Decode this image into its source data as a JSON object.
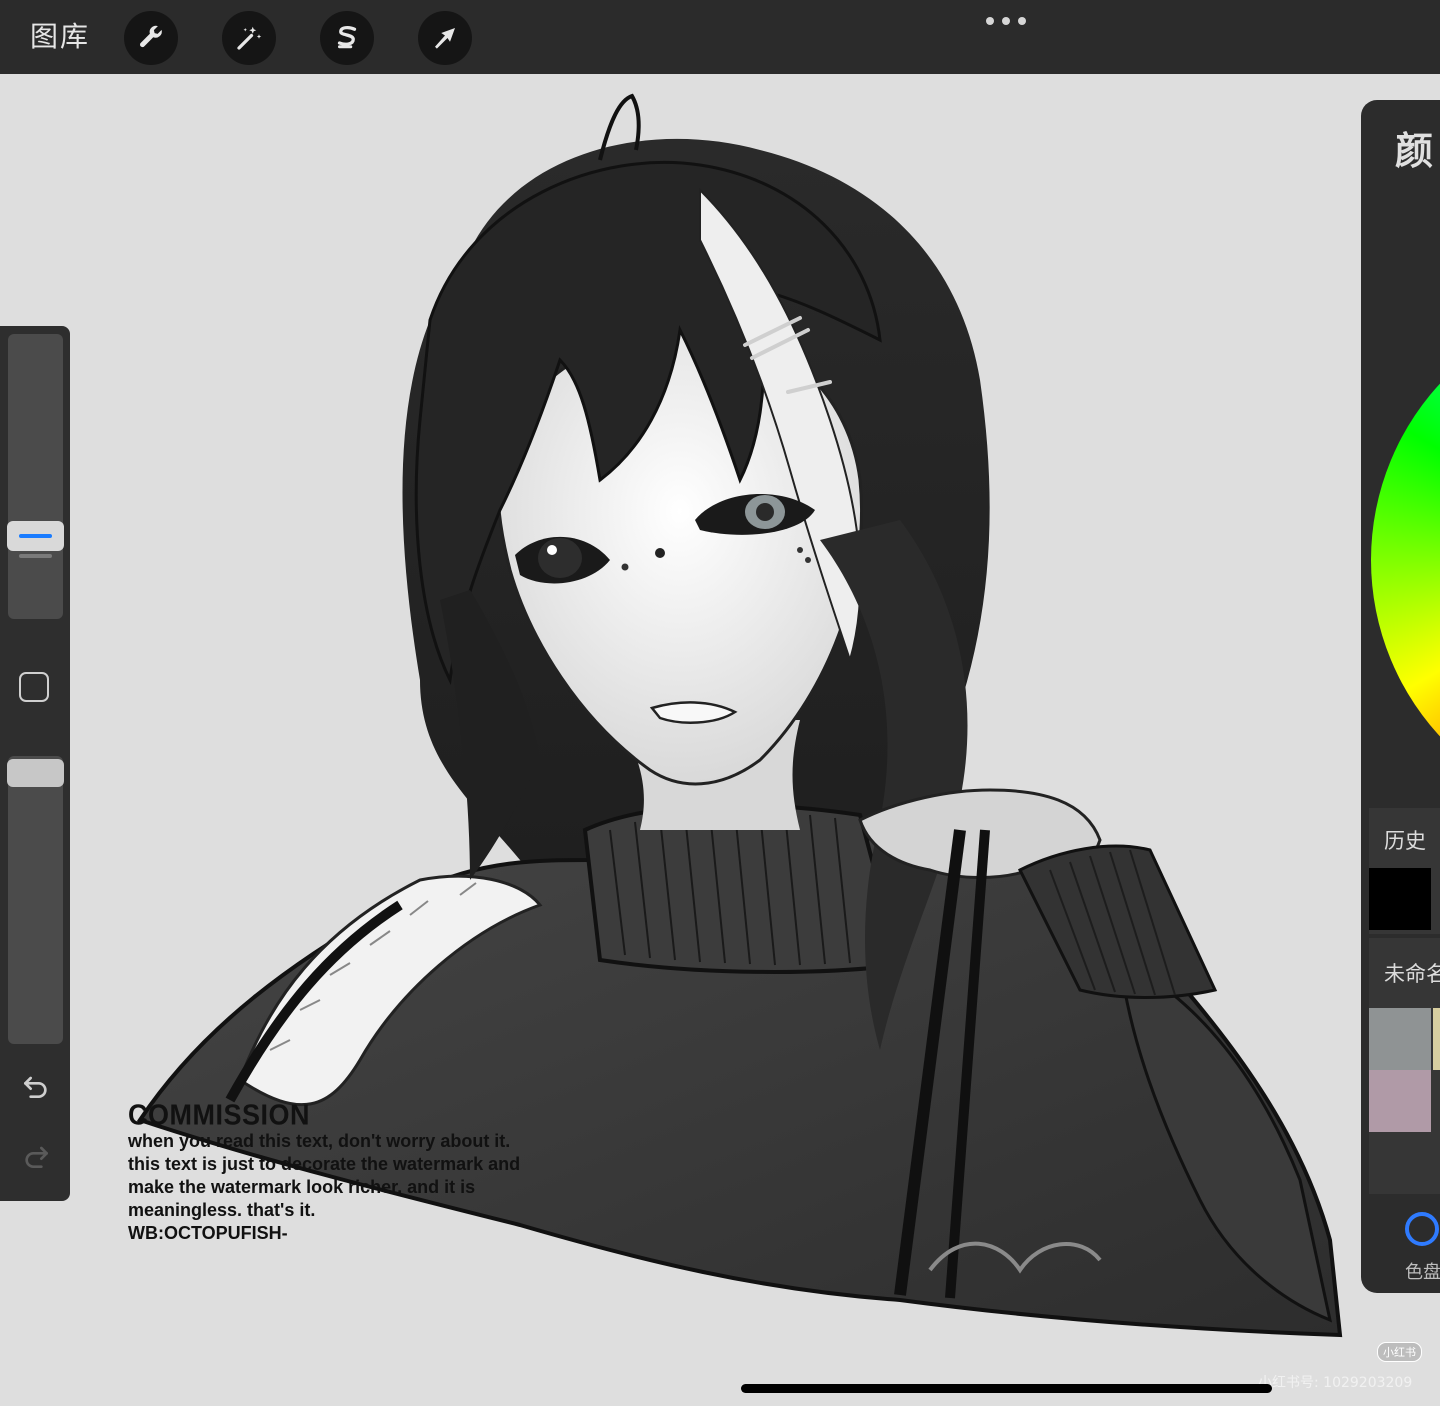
{
  "toolbar": {
    "gallery_label": "图库",
    "tools": [
      {
        "name": "actions",
        "icon": "wrench-icon"
      },
      {
        "name": "adjustments",
        "icon": "magic-wand-icon"
      },
      {
        "name": "selection",
        "icon": "selection-s-icon"
      },
      {
        "name": "transform",
        "icon": "arrow-cursor-icon"
      }
    ],
    "more_icon": "more-dots-icon"
  },
  "sidebar": {
    "size_icon": "brush-size-slider",
    "modify_icon": "square-modify-icon",
    "opacity_icon": "opacity-slider",
    "undo_icon": "undo-icon",
    "redo_icon": "redo-icon",
    "accent_color": "#1a7cff"
  },
  "artwork": {
    "watermark": {
      "title": "COMMISSION",
      "lines": [
        "when you read this text, don't worry about it.",
        "this text is just to decorate the watermark and",
        "make the watermark look richer, and it is",
        "meaningless. that's it.",
        "WB:OCTOPUFISH-"
      ]
    }
  },
  "color_panel": {
    "title": "颜",
    "history_label": "历史",
    "history_swatches": [
      "#000000"
    ],
    "palette_label": "未命名",
    "palette_swatches": [
      "#8f9394",
      "#b09aa7",
      "#d8cfa0"
    ],
    "palette_tab_label": "色盘",
    "tab_accent": "#2f7bff"
  },
  "footer": {
    "badge": "小红书",
    "id_text": "小红书号: 1029203209"
  }
}
